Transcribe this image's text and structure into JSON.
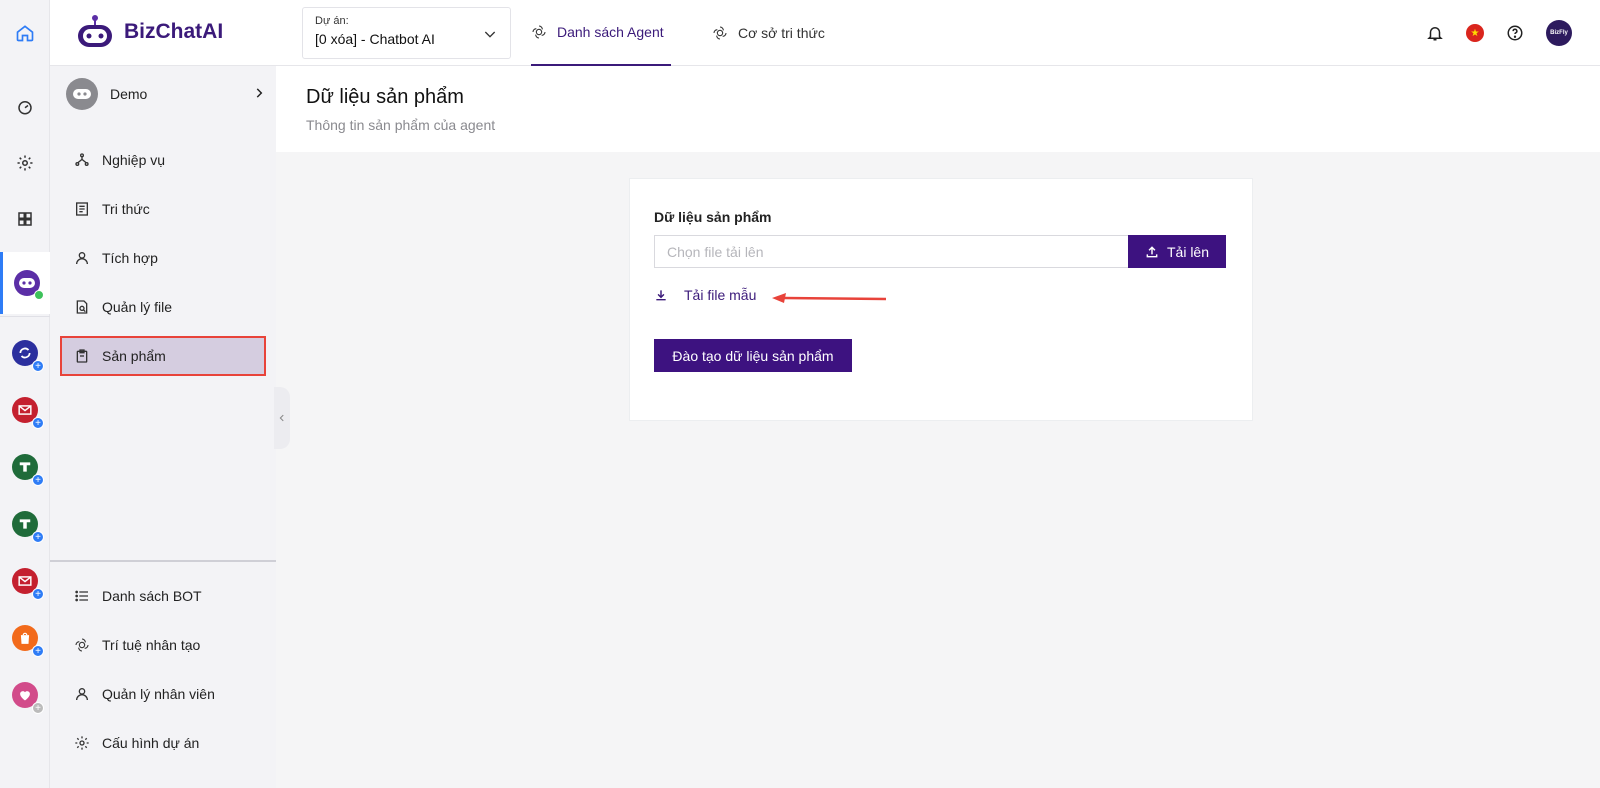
{
  "brand": {
    "name_part1": "Biz",
    "name_part2": "ChatAI"
  },
  "project": {
    "label": "Dự án:",
    "value": "[0 xóa] - Chatbot AI"
  },
  "tabs": [
    {
      "label": "Danh sách Agent",
      "active": true
    },
    {
      "label": "Cơ sở tri thức",
      "active": false
    }
  ],
  "header_icons": [
    "bell-icon",
    "vietnam-flag-icon",
    "help-icon",
    "user-avatar"
  ],
  "avatar_text": "BizFly",
  "sidebar": {
    "agent_name": "Demo",
    "items": [
      {
        "label": "Nghiệp vụ",
        "icon": "workflow-icon"
      },
      {
        "label": "Tri thức",
        "icon": "document-list-icon"
      },
      {
        "label": "Tích hợp",
        "icon": "user-icon"
      },
      {
        "label": "Quản lý file",
        "icon": "file-search-icon"
      },
      {
        "label": "Sản phẩm",
        "icon": "product-icon",
        "selected": true
      }
    ],
    "bottom_items": [
      {
        "label": "Danh sách BOT",
        "icon": "list-icon"
      },
      {
        "label": "Trí tuệ nhân tạo",
        "icon": "ai-icon"
      },
      {
        "label": "Quản lý nhân viên",
        "icon": "user-icon"
      },
      {
        "label": "Cấu hình dự án",
        "icon": "gear-icon"
      }
    ]
  },
  "rail_apps": [
    {
      "name": "dashboard-icon"
    },
    {
      "name": "settings-icon"
    },
    {
      "name": "apps-grid-icon"
    },
    {
      "name": "chatbot-app-icon",
      "color": "#5b2ea6"
    },
    {
      "name": "sync-app-icon",
      "color": "#2b2f9e"
    },
    {
      "name": "mail-app-icon",
      "color": "#c4202f"
    },
    {
      "name": "t-app-icon",
      "color": "#1f6b3a"
    },
    {
      "name": "t-app-icon-2",
      "color": "#1f6b3a"
    },
    {
      "name": "mail-app-icon-2",
      "color": "#c4202f"
    },
    {
      "name": "shop-app-icon",
      "color": "#f26a1b"
    },
    {
      "name": "heart-app-icon",
      "color": "#d24b8a"
    }
  ],
  "page": {
    "title": "Dữ liệu sản phẩm",
    "subtitle": "Thông tin sản phẩm của agent"
  },
  "form": {
    "field_label": "Dữ liệu sản phẩm",
    "file_placeholder": "Chọn file tải lên",
    "upload_label": "Tải lên",
    "download_sample_label": "Tải file mẫu",
    "train_label": "Đào tạo dữ liệu sản phẩm"
  },
  "colors": {
    "primary": "#3d1280",
    "highlight_border": "#e8433a",
    "selected_bg": "#d5cde0"
  }
}
